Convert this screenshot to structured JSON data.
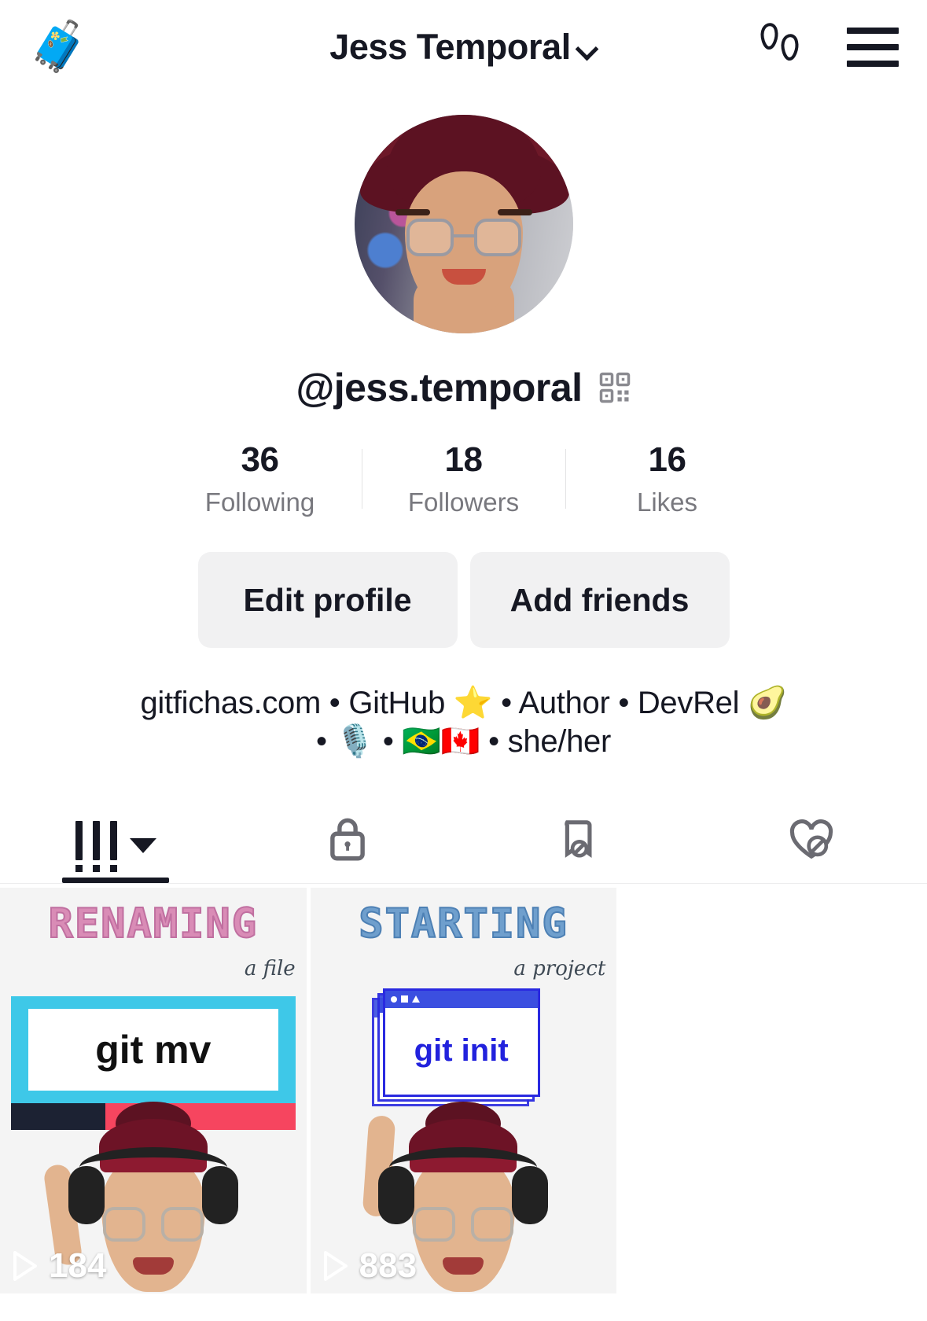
{
  "header": {
    "left_icon": "suitcase-icon",
    "suitcase_glyph": "🧳",
    "title": "Jess Temporal",
    "dropdown_icon": "chevron-down-icon",
    "footprints_icon": "footprints-icon",
    "menu_icon": "hamburger-menu-icon"
  },
  "profile": {
    "avatar_alt": "profile-avatar",
    "username": "@jess.temporal",
    "qr_icon": "qr-code-icon"
  },
  "stats": [
    {
      "count": "36",
      "label": "Following"
    },
    {
      "count": "18",
      "label": "Followers"
    },
    {
      "count": "16",
      "label": "Likes"
    }
  ],
  "actions": {
    "edit_profile": "Edit profile",
    "add_friends": "Add friends"
  },
  "bio": {
    "line1": "gitfichas.com • GitHub ⭐ • Author • DevRel 🥑",
    "line2": "• 🎙️ • 🇧🇷🇨🇦 • she/her",
    "full": "gitfichas.com • GitHub ⭐ • Author • DevRel 🥑 • 🎙️ • 🇧🇷🇨🇦 • she/her"
  },
  "tabs": [
    {
      "name": "videos",
      "icon": "grid-videos-icon",
      "active": true,
      "has_caret": true
    },
    {
      "name": "private",
      "icon": "lock-icon",
      "active": false,
      "has_caret": false
    },
    {
      "name": "saved",
      "icon": "bookmark-hidden-icon",
      "active": false,
      "has_caret": false
    },
    {
      "name": "liked",
      "icon": "heart-hidden-icon",
      "active": false,
      "has_caret": false
    }
  ],
  "videos": [
    {
      "title": "RENAMING",
      "subtitle": "a file",
      "command": "git mv",
      "views": "184",
      "play_icon": "play-icon",
      "accent": "#d98cb6"
    },
    {
      "title": "STARTING",
      "subtitle": "a project",
      "command": "git init",
      "views": "883",
      "play_icon": "play-icon",
      "accent": "#6f9fcd"
    }
  ],
  "colors": {
    "text": "#161823",
    "muted": "#78787e",
    "button_bg": "#f1f1f2",
    "divider": "#e3e3e4",
    "cyan": "#3ec8e8",
    "red": "#f6455f",
    "blue": "#2a2ae0"
  }
}
